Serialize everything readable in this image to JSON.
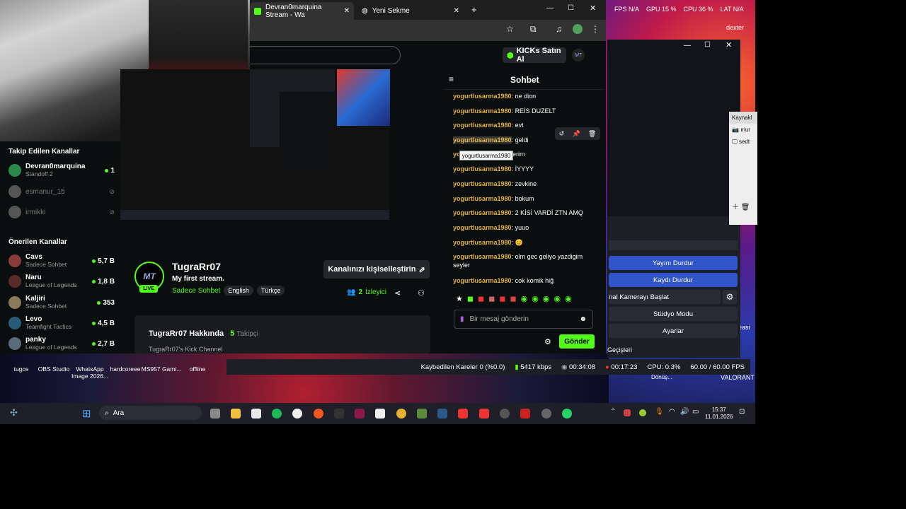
{
  "browser": {
    "tabs": [
      {
        "label": "Devran0marquina Stream - Wa"
      },
      {
        "label": "Yeni Sekme"
      }
    ],
    "kicks_button": "KICKs Satın Al"
  },
  "sidebar": {
    "followed_title": "Takip Edilen Kanallar",
    "followed": [
      {
        "name": "Devran0marquina",
        "sub": "Standoff 2",
        "count": "1",
        "live": true,
        "color": "#2a8a4a"
      },
      {
        "name": "esmanur_15",
        "sub": "",
        "count": "",
        "live": false,
        "color": "#555"
      },
      {
        "name": "irmikki",
        "sub": "",
        "count": "",
        "live": false,
        "color": "#555"
      }
    ],
    "suggested_title": "Önerilen Kanallar",
    "suggested": [
      {
        "name": "Cavs",
        "sub": "Sadece Sohbet",
        "count": "5,7 B",
        "color": "#8a3a3a"
      },
      {
        "name": "Naru",
        "sub": "League of Legends",
        "count": "1,8 B",
        "color": "#5a2a2a"
      },
      {
        "name": "Kaljiri",
        "sub": "Sadece Sohbet",
        "count": "353",
        "color": "#8a7a5a"
      },
      {
        "name": "Levo",
        "sub": "Teamfight Tactics",
        "count": "4,5 B",
        "color": "#2a5a7a"
      },
      {
        "name": "panky",
        "sub": "League of Legends",
        "count": "2,7 B",
        "color": "#5a6a7a"
      }
    ]
  },
  "profile": {
    "logo": "MT",
    "live": "LIVE",
    "username": "TugraRr07",
    "bio": "My first stream.",
    "category": "Sadece Sohbet",
    "tags": [
      "English",
      "Türkçe"
    ],
    "customize": "Kanalınızı kişiselleştirin",
    "viewers": "2",
    "viewers_label": "İzleyici",
    "about_title": "TugraRr07 Hakkında",
    "followers": "5",
    "followers_label": "Takipçi",
    "about_text": "TugraRr07's Kick Channel"
  },
  "chat": {
    "title": "Sohbet",
    "messages": [
      {
        "user": "yogurtlusarma1980",
        "text": "ne dion"
      },
      {
        "user": "yogurtlusarma1980",
        "text": "REİS DUZELT"
      },
      {
        "user": "yogurtlusarma1980",
        "text": "evt"
      },
      {
        "user": "yogurtlusarma1980",
        "text": "geldi"
      },
      {
        "user": "yo",
        "text": "aferim"
      },
      {
        "user": "yogurtlusarma1980",
        "text": "İYYYY"
      },
      {
        "user": "yogurtlusarma1980",
        "text": "zevkine"
      },
      {
        "user": "yogurtlusarma1980",
        "text": "bokum"
      },
      {
        "user": "yogurtlusarma1980",
        "text": "2 KİSİ VARDİ ZTN AMQ"
      },
      {
        "user": "yogurtlusarma1980",
        "text": "yuuo"
      },
      {
        "user": "yogurtlusarma1980",
        "text": "😊"
      },
      {
        "user": "yogurtlusarma1980",
        "text": "olm gec geliyo yazdigim seyler"
      },
      {
        "user": "yogurtlusarma1980",
        "text": "cok komik hiğ"
      }
    ],
    "tooltip": "yogurtlusarma1980",
    "placeholder": "Bir mesaj gönderin",
    "send": "Gönder"
  },
  "obs": {
    "buttons": [
      "Yayını Durdur",
      "Kaydı Durdur",
      "nal Kamerayı Başlat",
      "Stüdyo Modu",
      "Ayarlar"
    ],
    "transitions": "Geçişleri",
    "sources": [
      "ıriur",
      "sedt"
    ],
    "sources_title": "Kaynakl",
    "status": {
      "dropped": "Kaybedilen Kareler 0 (%0.0)",
      "bitrate": "5417 kbps",
      "stream_time": "00:34:08",
      "rec_time": "00:17:23",
      "cpu": "CPU: 0.3%",
      "fps": "60.00 / 60.00 FPS"
    }
  },
  "overlay": {
    "fps": "FPS  N/A",
    "gpu": "GPU  15 %",
    "cpu": "CPU  36 %",
    "lat": "LAT  N/A",
    "user": "dexter",
    "dono": "Dönüş...",
    "valorant": "VALORANT",
    "easi": "easi"
  },
  "desktop": [
    "tugce",
    "OBS Studio",
    "WhatsApp Image 2026...",
    "hardcoreee",
    "MS957 Gami...",
    "offline"
  ],
  "taskbar": {
    "search": "Ara",
    "time": "15:37",
    "date": "11.01.2026"
  }
}
